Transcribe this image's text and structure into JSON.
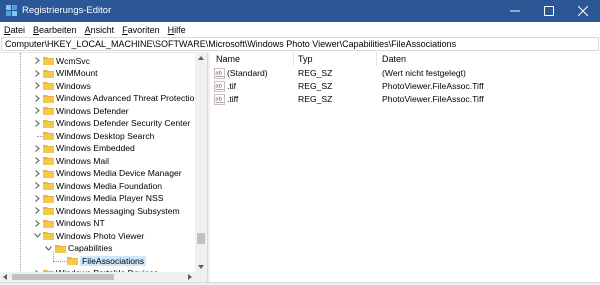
{
  "window": {
    "title": "Registrierungs-Editor",
    "titlebar_color": "#2b5797"
  },
  "menu": [
    {
      "pre": "",
      "u": "D",
      "post": "atei"
    },
    {
      "pre": "",
      "u": "B",
      "post": "earbeiten"
    },
    {
      "pre": "",
      "u": "A",
      "post": "nsicht"
    },
    {
      "pre": "",
      "u": "F",
      "post": "avoriten"
    },
    {
      "pre": "",
      "u": "H",
      "post": "ilfe"
    }
  ],
  "address": "Computer\\HKEY_LOCAL_MACHINE\\SOFTWARE\\Microsoft\\Windows Photo Viewer\\Capabilities\\FileAssociations",
  "tree": [
    {
      "label": "WcmSvc",
      "expander": "collapsed",
      "level": 0
    },
    {
      "label": "WIMMount",
      "expander": "collapsed",
      "level": 0
    },
    {
      "label": "Windows",
      "expander": "collapsed",
      "level": 0
    },
    {
      "label": "Windows Advanced Threat Protection",
      "expander": "collapsed",
      "level": 0
    },
    {
      "label": "Windows Defender",
      "expander": "collapsed",
      "level": 0
    },
    {
      "label": "Windows Defender Security Center",
      "expander": "collapsed",
      "level": 0
    },
    {
      "label": "Windows Desktop Search",
      "expander": "none",
      "level": 0
    },
    {
      "label": "Windows Embedded",
      "expander": "collapsed",
      "level": 0
    },
    {
      "label": "Windows Mail",
      "expander": "collapsed",
      "level": 0
    },
    {
      "label": "Windows Media Device Manager",
      "expander": "collapsed",
      "level": 0
    },
    {
      "label": "Windows Media Foundation",
      "expander": "collapsed",
      "level": 0
    },
    {
      "label": "Windows Media Player NSS",
      "expander": "collapsed",
      "level": 0
    },
    {
      "label": "Windows Messaging Subsystem",
      "expander": "collapsed",
      "level": 0
    },
    {
      "label": "Windows NT",
      "expander": "collapsed",
      "level": 0
    },
    {
      "label": "Windows Photo Viewer",
      "expander": "expanded",
      "level": 0
    },
    {
      "label": "Capabilities",
      "expander": "expanded",
      "level": 1
    },
    {
      "label": "FileAssociations",
      "expander": "none",
      "level": 2,
      "selected": true
    },
    {
      "label": "Windows Portable Devices",
      "expander": "collapsed",
      "level": 0
    }
  ],
  "columns": {
    "name": "Name",
    "type": "Typ",
    "data": "Daten"
  },
  "values": [
    {
      "name": "(Standard)",
      "type": "REG_SZ",
      "data": "(Wert nicht festgelegt)"
    },
    {
      "name": ".tif",
      "type": "REG_SZ",
      "data": "PhotoViewer.FileAssoc.Tiff"
    },
    {
      "name": ".tiff",
      "type": "REG_SZ",
      "data": "PhotoViewer.FileAssoc.Tiff"
    }
  ],
  "icons": {
    "folder": "folder-icon",
    "string_value": "ab-string-value-icon",
    "app": "regedit-icon"
  },
  "colors": {
    "folder": "#e8b538",
    "selection": "#cce8ff",
    "string_icon": "#c0392b"
  }
}
